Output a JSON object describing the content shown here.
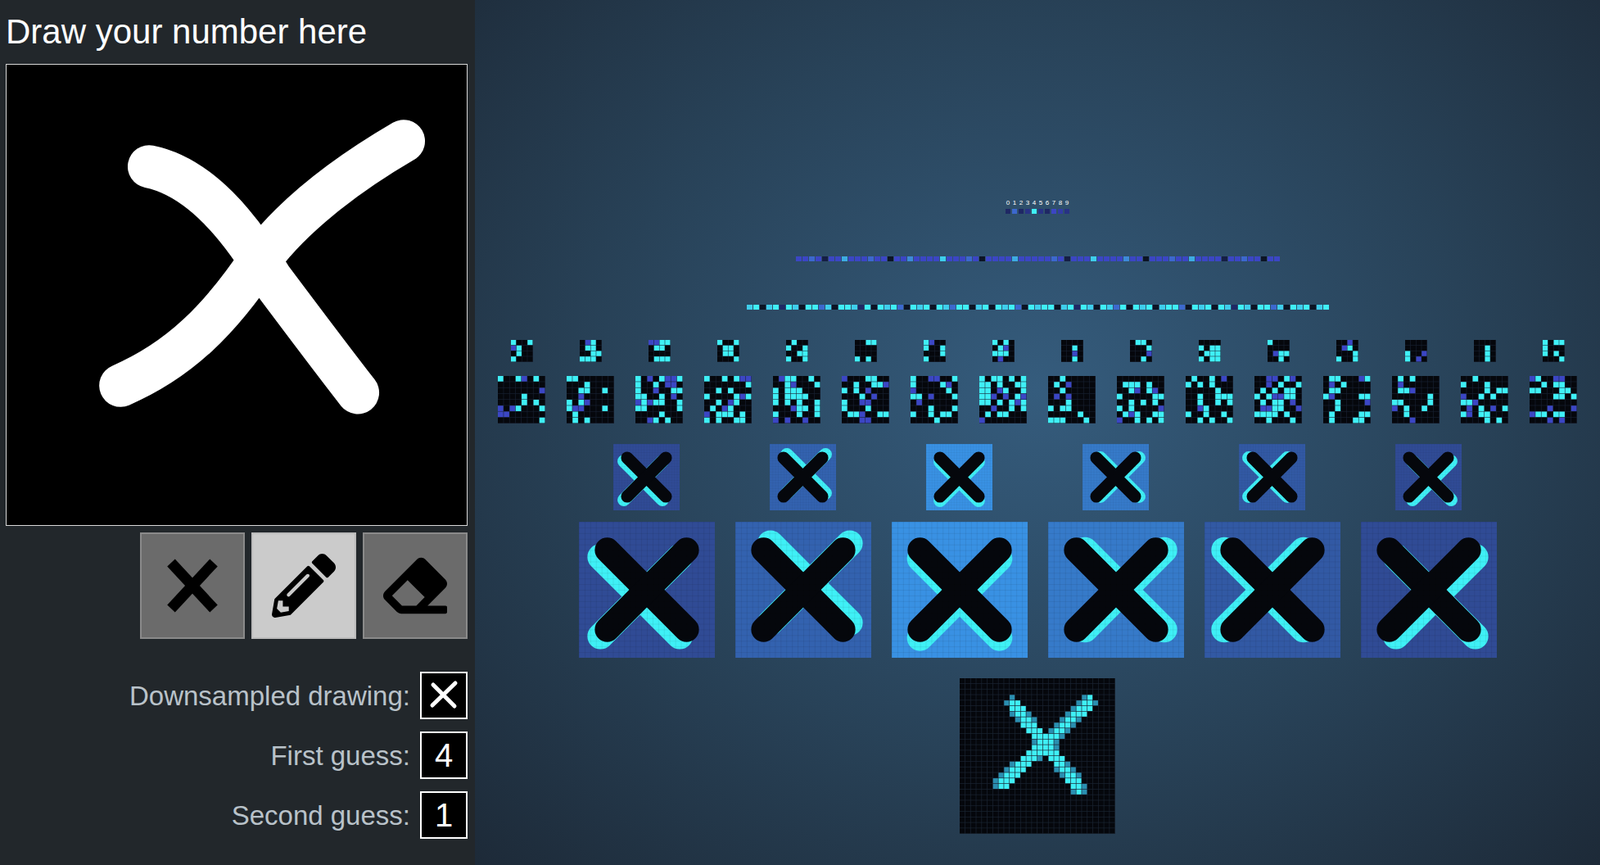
{
  "left_panel": {
    "title": "Draw your number here",
    "tools": [
      {
        "kind": "clear",
        "selected": false
      },
      {
        "kind": "pencil",
        "selected": true
      },
      {
        "kind": "eraser",
        "selected": false
      }
    ],
    "results": [
      {
        "label": "Downsampled drawing:",
        "kind": "image",
        "value": ""
      },
      {
        "label": "First guess:",
        "kind": "text",
        "value": "4"
      },
      {
        "label": "Second guess:",
        "kind": "text",
        "value": "1"
      }
    ]
  },
  "network": {
    "output": [
      {
        "label": "0",
        "level": 0.2
      },
      {
        "label": "1",
        "level": 0.6
      },
      {
        "label": "2",
        "level": 0.2
      },
      {
        "label": "3",
        "level": 0.3
      },
      {
        "label": "4",
        "level": 1.0
      },
      {
        "label": "5",
        "level": 0.3
      },
      {
        "label": "6",
        "level": 0.2
      },
      {
        "label": "7",
        "level": 0.5
      },
      {
        "label": "8",
        "level": 0.4
      },
      {
        "label": "9",
        "level": 0.3
      }
    ],
    "fc2": [
      0.5,
      0.5,
      0.6,
      0.5,
      0.1,
      0.5,
      0.5,
      0.8,
      0.5,
      0.5,
      0.5,
      0.6,
      0.5,
      0.5,
      0.0,
      0.5,
      0.5,
      0.7,
      0.5,
      0.5,
      0.5,
      0.5,
      0.9,
      0.5,
      0.5,
      0.5,
      0.6,
      0.5,
      0.0,
      0.5,
      0.5,
      0.5,
      0.5,
      0.8,
      0.5,
      0.5,
      0.5,
      0.5,
      0.5,
      0.6,
      0.5,
      0.1,
      0.5,
      0.5,
      0.5,
      0.9,
      0.5,
      0.5,
      0.5,
      0.5,
      0.7,
      0.5,
      0.5,
      0.0,
      0.5,
      0.5,
      0.5,
      0.6,
      0.5,
      0.5,
      0.8,
      0.5,
      0.5,
      0.5,
      0.5,
      0.1,
      0.5,
      0.5,
      0.6,
      0.5,
      0.5,
      0.0,
      0.5,
      0.5
    ],
    "fc1": [
      0.9,
      1.0,
      0.0,
      0.9,
      1.0,
      0.2,
      1.0,
      0.9,
      0.0,
      1.0,
      1.0,
      0.6,
      0.9,
      0.0,
      1.0,
      1.0,
      0.9,
      0.2,
      1.0,
      0.0,
      1.0,
      0.9,
      1.0,
      0.6,
      0.0,
      1.0,
      0.9,
      1.0,
      0.0,
      1.0,
      0.9,
      0.6,
      1.0,
      1.0,
      0.0,
      0.9,
      1.0,
      0.0,
      1.0,
      0.9,
      1.0,
      0.6,
      0.0,
      1.0,
      0.9,
      1.0,
      1.0,
      0.0,
      0.9,
      1.0,
      0.2,
      1.0,
      0.9,
      0.0,
      1.0,
      0.9,
      0.6,
      1.0,
      0.0,
      1.0,
      0.9,
      1.0,
      0.0,
      0.9,
      1.0,
      1.0,
      0.6,
      0.0,
      1.0,
      0.9,
      1.0,
      0.0,
      1.0,
      0.9,
      0.2,
      1.0,
      0.9,
      0.0,
      1.0,
      1.0,
      0.6,
      0.9,
      0.0,
      1.0,
      0.9,
      1.0,
      0.0,
      0.9,
      1.0
    ],
    "conv2": [
      {
        "level": 0.4
      },
      {
        "level": 0.45
      },
      {
        "level": 0.6
      },
      {
        "level": 0.5
      },
      {
        "level": 0.55
      },
      {
        "level": 0.4
      },
      {
        "level": 0.35
      },
      {
        "level": 0.5
      },
      {
        "level": 0.3
      },
      {
        "level": 0.45
      },
      {
        "level": 0.55
      },
      {
        "level": 0.6
      },
      {
        "level": 0.4
      },
      {
        "level": 0.35
      },
      {
        "level": 0.3
      },
      {
        "level": 0.5
      }
    ],
    "conv1": [
      {
        "level": 0.2
      },
      {
        "level": 0.45
      },
      {
        "level": 0.95
      },
      {
        "level": 0.7
      },
      {
        "level": 0.35
      },
      {
        "level": 0.2
      }
    ]
  }
}
